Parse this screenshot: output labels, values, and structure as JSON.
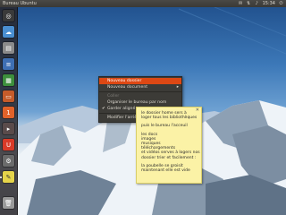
{
  "top_panel": {
    "title": "Bureau Ubuntu",
    "clock": "15:34",
    "indicators": [
      "mail-icon",
      "network-icon",
      "volume-icon",
      "power-icon"
    ]
  },
  "launcher": {
    "items": [
      {
        "name": "dash-home",
        "icon": "ubuntu-logo-icon",
        "color": "#3a3a3a",
        "glyph": "◎"
      },
      {
        "name": "software-center",
        "icon": "software-center-icon",
        "color": "#4a8fd1",
        "glyph": "☁"
      },
      {
        "name": "files",
        "icon": "files-icon",
        "color": "#8a8a8a",
        "glyph": "▤"
      },
      {
        "name": "writer",
        "icon": "writer-icon",
        "color": "#3e6fb3",
        "glyph": "≡"
      },
      {
        "name": "calc",
        "icon": "calc-icon",
        "color": "#3d8f3d",
        "glyph": "▦"
      },
      {
        "name": "impress",
        "icon": "impress-icon",
        "color": "#c45b2a",
        "glyph": "▭"
      },
      {
        "name": "ubuntu-one",
        "icon": "ubuntu-one-icon",
        "color": "#e0622a",
        "glyph": "1"
      },
      {
        "name": "terminal",
        "icon": "terminal-icon",
        "color": "#5a4b4b",
        "glyph": "▸"
      },
      {
        "name": "ubuntu-one-2",
        "icon": "ubuntu-one-music-icon",
        "color": "#d93a28",
        "glyph": "U"
      },
      {
        "name": "system-settings",
        "icon": "settings-icon",
        "color": "#6b6b6b",
        "glyph": "⚙"
      },
      {
        "name": "notes",
        "icon": "sticky-notes-icon",
        "color": "#e6d44a",
        "glyph": "✎"
      },
      {
        "name": "trash",
        "icon": "trash-icon",
        "color": "#9a9a9a",
        "glyph": "🗑"
      }
    ]
  },
  "context_menu": {
    "items": [
      {
        "label": "Nouveau dossier",
        "state": "highlighted"
      },
      {
        "label": "Nouveau document",
        "state": "normal",
        "submenu": true
      },
      {
        "separator": true
      },
      {
        "label": "Coller",
        "state": "disabled"
      },
      {
        "label": "Organiser le bureau par nom",
        "state": "normal"
      },
      {
        "label": "Garder aligné",
        "state": "normal",
        "checked": true
      },
      {
        "separator": true
      },
      {
        "label": "Modifier l'arrière-plan du bureau",
        "state": "normal"
      }
    ]
  },
  "note": {
    "lines": [
      "le dossier home sers à",
      "loger tous les bibliothèques",
      "",
      "puis le bureau l'acceuil",
      "",
      "les docs",
      "images",
      "musiques",
      "téléchargements",
      "et vidéos serves à logers nos",
      "dossier trier et facilement :",
      "",
      "la poubelle se groisit",
      "maintenant elle est vide"
    ]
  }
}
